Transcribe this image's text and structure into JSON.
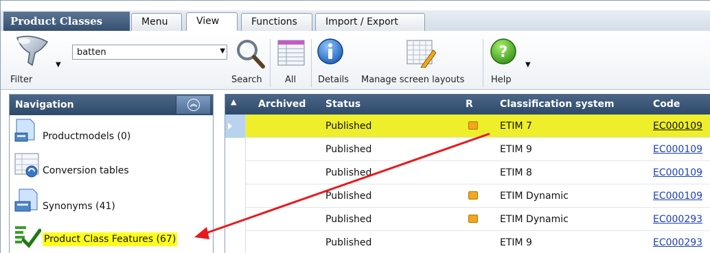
{
  "app_title": "Product Classes",
  "tabs": [
    {
      "label": "Menu",
      "active": false
    },
    {
      "label": "View",
      "active": true
    },
    {
      "label": "Functions",
      "active": false
    },
    {
      "label": "Import / Export",
      "active": false
    }
  ],
  "toolbar": {
    "filter_label": "Filter",
    "search_value": "batten",
    "search_label": "Search",
    "all_label": "All",
    "details_label": "Details",
    "layouts_label": "Manage screen layouts",
    "help_label": "Help"
  },
  "navigation": {
    "title": "Navigation",
    "items": [
      {
        "label": "Productmodels (0)",
        "icon": "productmodels-icon"
      },
      {
        "label": "Conversion tables",
        "icon": "conversion-tables-icon"
      },
      {
        "label": "Synonyms (41)",
        "icon": "synonyms-icon"
      },
      {
        "label": "Product Class Features (67)",
        "icon": "product-class-features-icon",
        "highlighted": true
      }
    ]
  },
  "grid": {
    "columns": {
      "sort": "▲",
      "archived": "Archived",
      "status": "Status",
      "r": "R",
      "classification": "Classification system",
      "code": "Code"
    },
    "rows": [
      {
        "status": "Published",
        "r": true,
        "classification": "ETIM 7",
        "code": "EC000109",
        "highlighted": true
      },
      {
        "status": "Published",
        "r": false,
        "classification": "ETIM 9",
        "code": "EC000109"
      },
      {
        "status": "Published",
        "r": false,
        "classification": "ETIM 8",
        "code": "EC000109"
      },
      {
        "status": "Published",
        "r": true,
        "classification": "ETIM Dynamic",
        "code": "EC000109"
      },
      {
        "status": "Published",
        "r": true,
        "classification": "ETIM Dynamic",
        "code": "EC000293"
      },
      {
        "status": "Published",
        "r": false,
        "classification": "ETIM 9",
        "code": "EC000293"
      }
    ]
  },
  "colors": {
    "header_bg": "#2e4a6a",
    "highlight": "#eeee2a",
    "r_marker": "#f2a71c",
    "link": "#1a3fb5",
    "arrow": "#e8191b"
  }
}
